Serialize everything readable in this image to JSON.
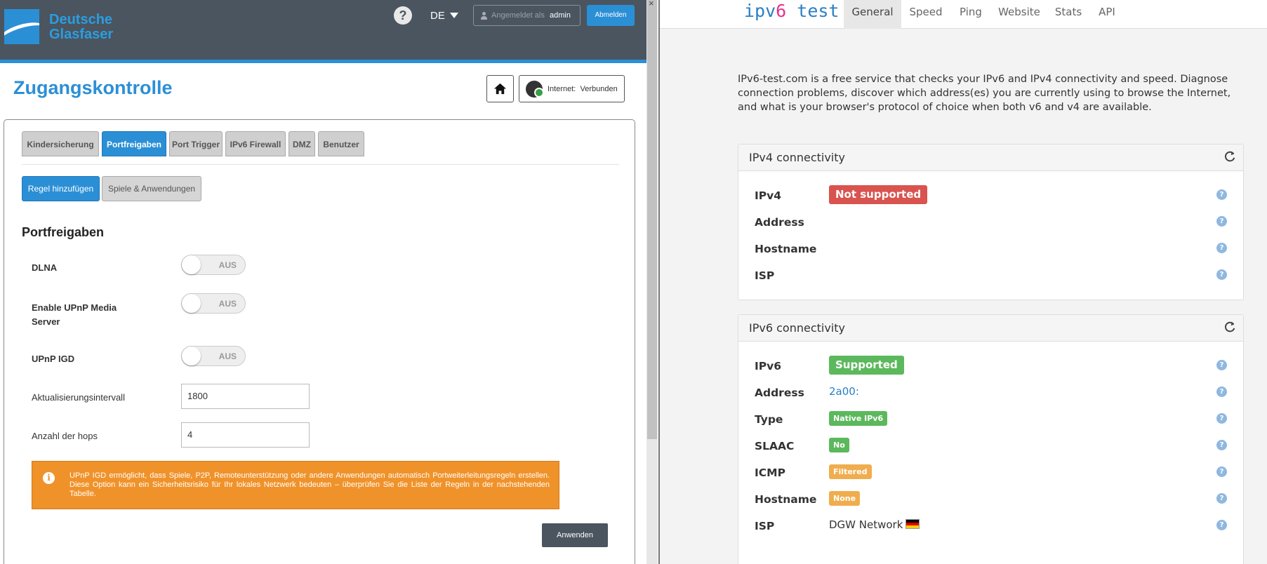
{
  "left": {
    "brand": {
      "line1": "Deutsche",
      "line2": "Glasfaser"
    },
    "header": {
      "help": "?",
      "language": "DE",
      "login_label": "Angemeldet als",
      "username": "admin",
      "logout_label": "Abmelden"
    },
    "page_title": "Zugangskontrolle",
    "status": {
      "label": "Internet:",
      "value": "Verbunden"
    },
    "tabs": [
      {
        "label": "Kindersicherung",
        "active": false
      },
      {
        "label": "Portfreigaben",
        "active": true
      },
      {
        "label": "Port Trigger",
        "active": false
      },
      {
        "label": "IPv6 Firewall",
        "active": false
      },
      {
        "label": "DMZ",
        "active": false
      },
      {
        "label": "Benutzer",
        "active": false
      }
    ],
    "sub_buttons": {
      "add_rule": "Regel hinzufügen",
      "games": "Spiele & Anwendungen"
    },
    "section_title": "Portfreigaben",
    "settings": {
      "dlna": {
        "label": "DLNA",
        "value": "AUS"
      },
      "upnp_media": {
        "label_line1": "Enable UPnP Media",
        "label_line2": "Server",
        "value": "AUS"
      },
      "upnp_igd": {
        "label": "UPnP IGD",
        "value": "AUS"
      },
      "update_interval": {
        "label": "Aktualisierungsintervall",
        "value": "1800"
      },
      "hops": {
        "label": "Anzahl der hops",
        "value": "4"
      }
    },
    "notice": "UPnP IGD ermöglicht, dass Spiele, P2P, Remoteunterstützung oder andere Anwendungen automatisch Portweiterleitungsregeln erstellen. Diese Option kann ein Sicherheitsrisiko für Ihr lokales Netzwerk bedeuten – überprüfen Sie die Liste der Regeln in der nachstehenden Tabelle.",
    "apply_label": "Anwenden"
  },
  "right": {
    "brand_prefix": "ipv",
    "brand_six": "6",
    "brand_suffix": " test",
    "nav": [
      {
        "label": "General",
        "active": true
      },
      {
        "label": "Speed",
        "active": false
      },
      {
        "label": "Ping",
        "active": false
      },
      {
        "label": "Website",
        "active": false
      },
      {
        "label": "Stats",
        "active": false
      },
      {
        "label": "API",
        "active": false
      }
    ],
    "intro": "IPv6-test.com is a free service that checks your IPv6 and IPv4 connectivity and speed. Diagnose connection problems, discover which address(es) you are currently using to browse the Internet, and what is your browser's protocol of choice when both v6 and v4 are available.",
    "ipv4": {
      "title": "IPv4 connectivity",
      "rows": [
        {
          "key": "IPv4",
          "value": "Not supported",
          "style": "badge-big-red"
        },
        {
          "key": "Address",
          "value": "",
          "style": "text"
        },
        {
          "key": "Hostname",
          "value": "",
          "style": "text"
        },
        {
          "key": "ISP",
          "value": "",
          "style": "text"
        }
      ]
    },
    "ipv6": {
      "title": "IPv6 connectivity",
      "rows": [
        {
          "key": "IPv6",
          "value": "Supported",
          "style": "badge-big-green"
        },
        {
          "key": "Address",
          "value": "2a00:",
          "style": "link"
        },
        {
          "key": "Type",
          "value": "Native IPv6",
          "style": "badge-small-green"
        },
        {
          "key": "SLAAC",
          "value": "No",
          "style": "badge-small-green"
        },
        {
          "key": "ICMP",
          "value": "Filtered",
          "style": "badge-small-orange"
        },
        {
          "key": "Hostname",
          "value": "None",
          "style": "badge-small-orange"
        },
        {
          "key": "ISP",
          "value": "DGW Network",
          "style": "text-flag"
        }
      ]
    },
    "colors": {
      "accent_blue": "#2b8fd6",
      "badge_red": "#d9534f",
      "badge_green": "#5cb85c",
      "badge_orange": "#f0ad4e",
      "brand_pink": "#e8318a"
    },
    "icons": [
      "refresh-icon",
      "help-icon",
      "germany-flag-icon"
    ]
  }
}
